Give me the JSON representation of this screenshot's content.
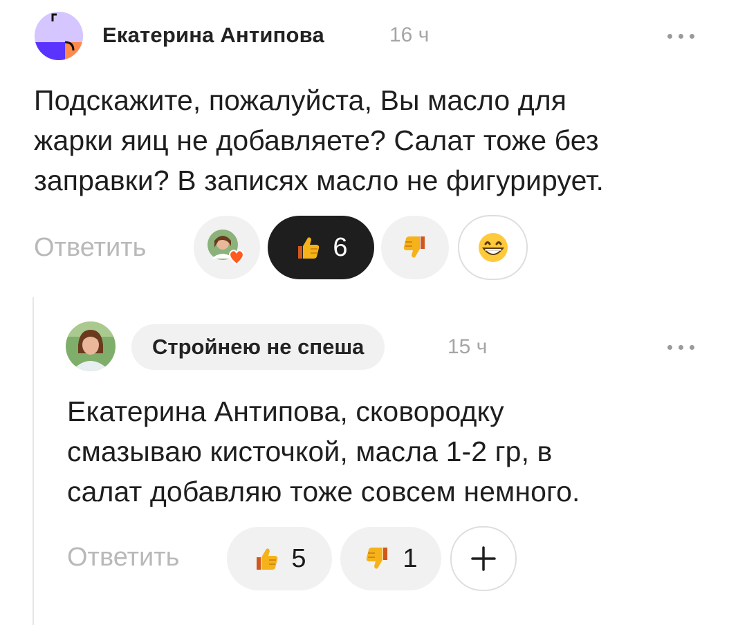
{
  "comment": {
    "author": "Екатерина Антипова",
    "time": "16 ч",
    "text_lines": [
      "Подскажите, пожалуйста, Вы масло для",
      "жарки яиц не добавляете? Салат тоже без",
      "заправки? В записях масло не фигурирует."
    ],
    "reply_label": "Ответить",
    "likes": "6",
    "more_icon": "more-horizontal-icon"
  },
  "reply": {
    "author": "Стройнею не спеша",
    "time": "15 ч",
    "text_lines": [
      "Екатерина Антипова, сковородку",
      "смазываю кисточкой, масла 1-2 гр, в",
      "салат добавляю тоже совсем немного."
    ],
    "reply_label": "Ответить",
    "likes": "5",
    "dislikes": "1",
    "add_reaction_icon": "plus-icon"
  },
  "colors": {
    "accent_dark_pill": "#1e1e1e",
    "pill_bg": "#f1f1f1",
    "muted_text": "#b9b9b9",
    "heart": "#ff5a1f",
    "thumb_yellow": "#f5b21a"
  }
}
